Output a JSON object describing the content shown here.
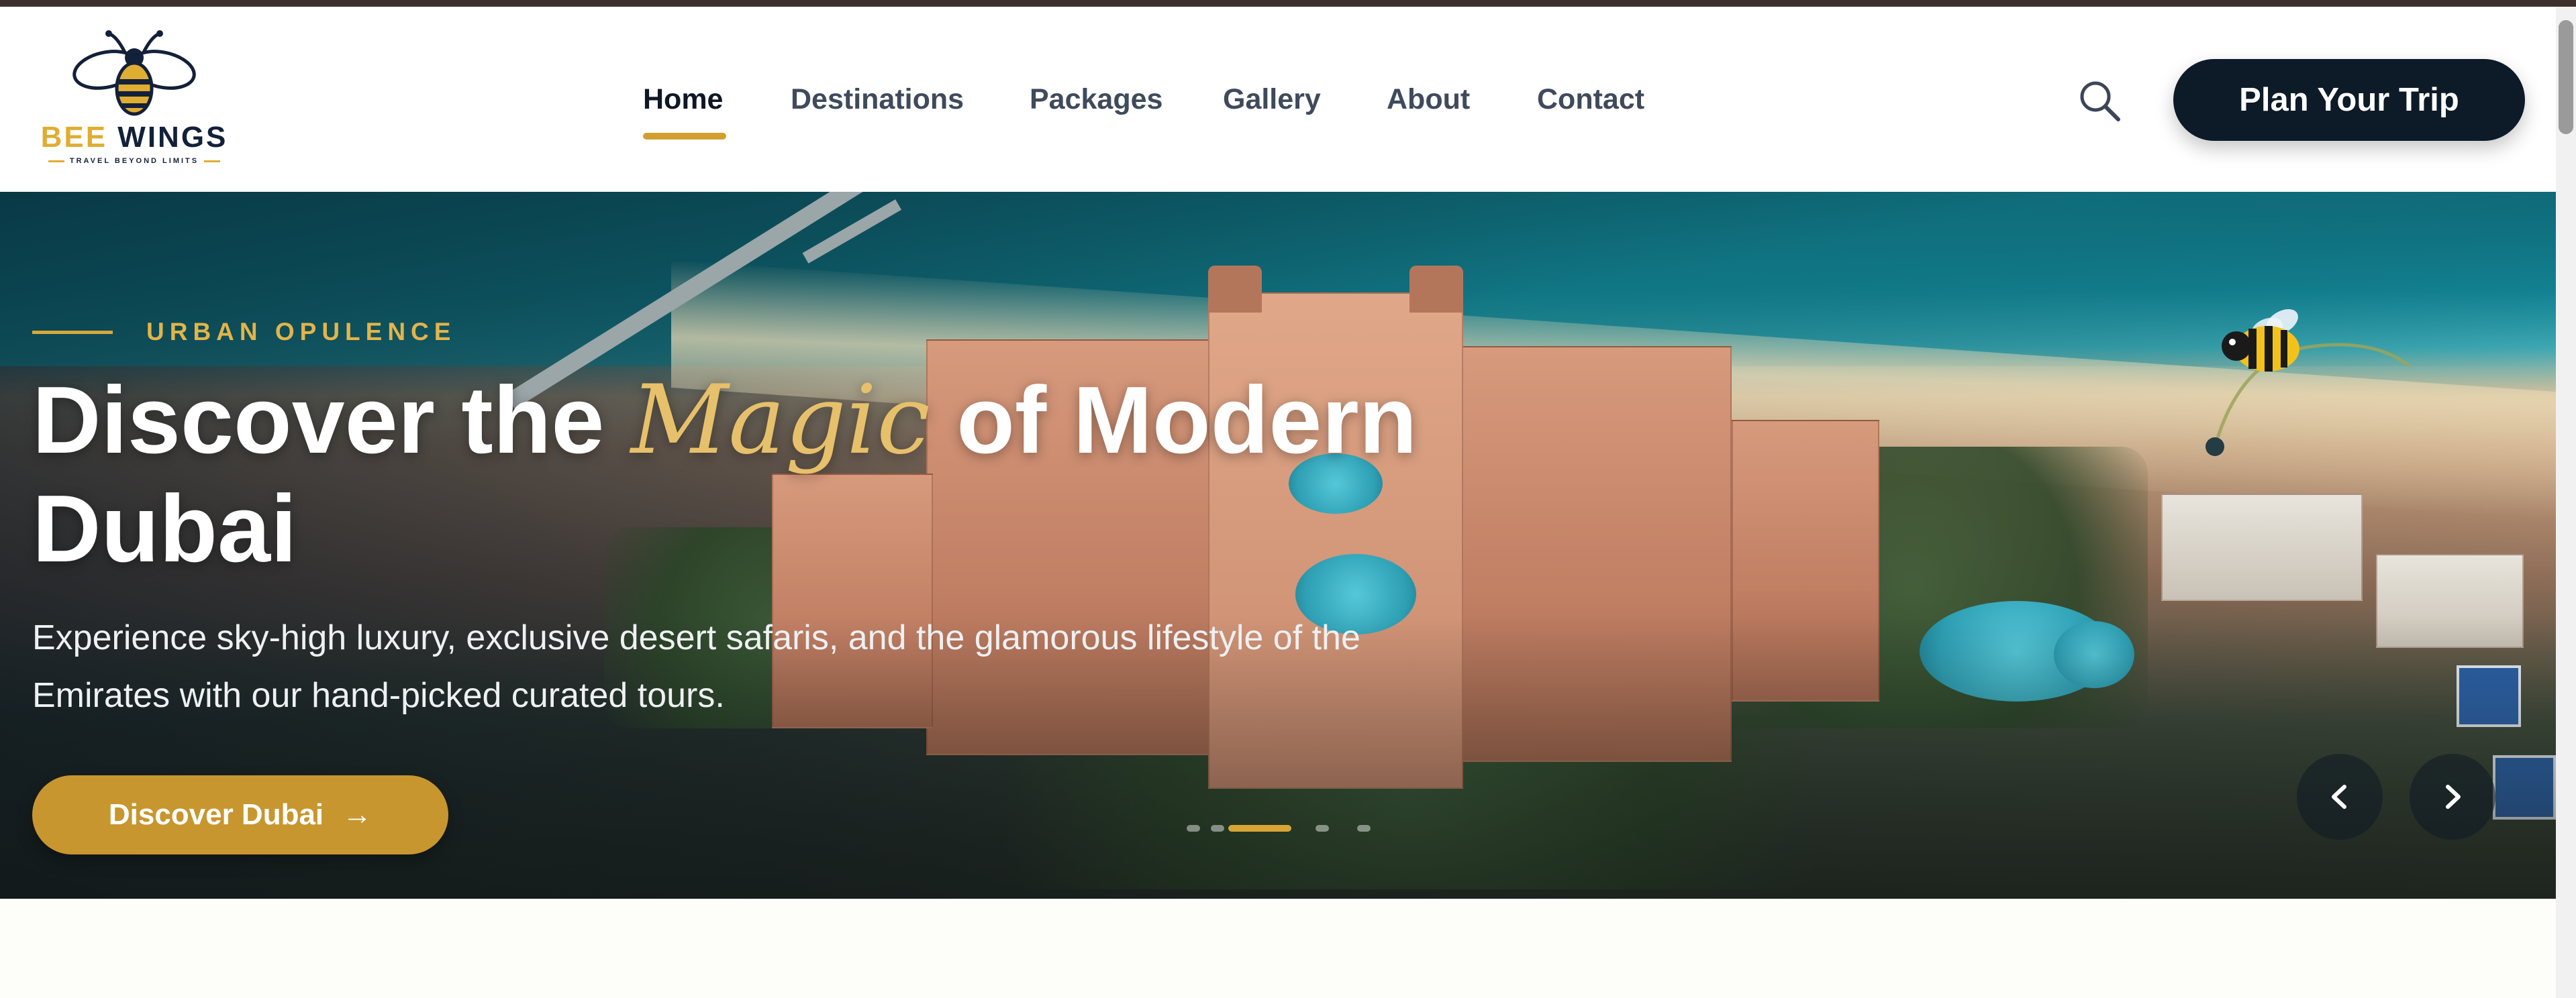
{
  "brand": {
    "name_part1": "BEE",
    "name_part2": "WINGS",
    "tagline": "TRAVEL BEYOND LIMITS",
    "accent_color": "#e0ad33",
    "navy_color": "#13203a"
  },
  "nav": {
    "items": [
      {
        "label": "Home",
        "active": true
      },
      {
        "label": "Destinations",
        "active": false
      },
      {
        "label": "Packages",
        "active": false
      },
      {
        "label": "Gallery",
        "active": false
      },
      {
        "label": "About",
        "active": false
      },
      {
        "label": "Contact",
        "active": false
      }
    ],
    "search_icon": "search-icon",
    "cta_label": "Plan Your Trip"
  },
  "hero": {
    "eyebrow": "URBAN OPULENCE",
    "title_before": "Discover the ",
    "title_highlight": "Magic",
    "title_after": " of Modern Dubai",
    "subtitle": "Experience sky-high luxury, exclusive desert safaris, and the glamorous lifestyle of the Emirates with our hand-picked curated tours.",
    "cta_label": "Discover Dubai",
    "cta_icon": "arrow-right-icon",
    "cta_color": "#c8962f",
    "slides_total": 5,
    "active_slide": 2,
    "prev_icon": "chevron-left-icon",
    "next_icon": "chevron-right-icon"
  }
}
